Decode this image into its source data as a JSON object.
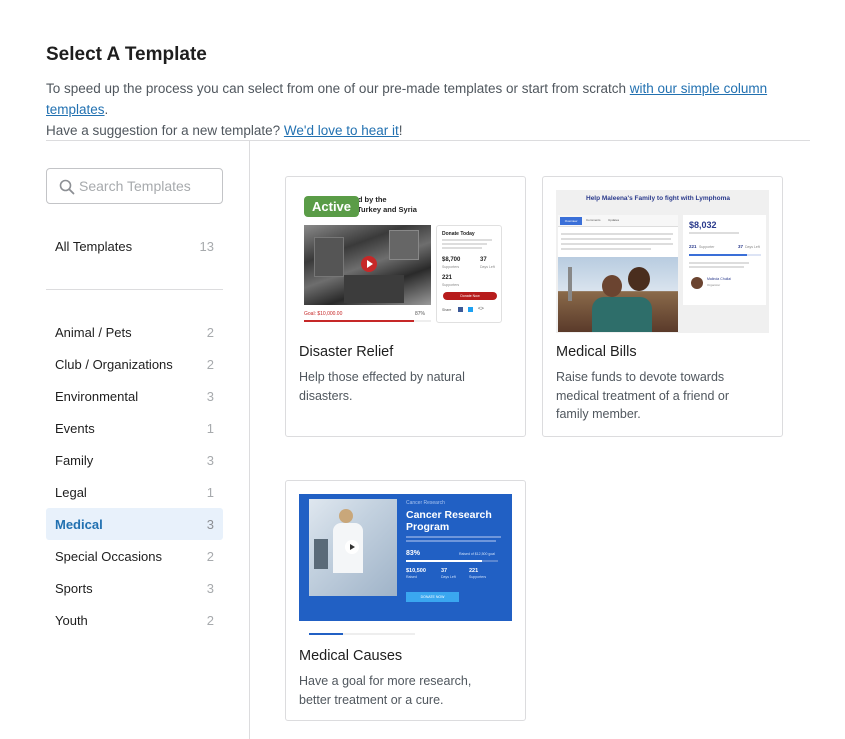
{
  "header": {
    "title": "Select A Template",
    "intro_text": "To speed up the process you can select from one of our pre-made templates or start from scratch ",
    "intro_link": "with our simple column templates",
    "intro_end": ".",
    "suggest_text": "Have a suggestion for a new template? ",
    "suggest_link": "We'd love to hear it",
    "suggest_end": "!"
  },
  "search": {
    "placeholder": "Search Templates"
  },
  "all_templates": {
    "label": "All Templates",
    "count": "13"
  },
  "categories": [
    {
      "label": "Animal / Pets",
      "count": "2"
    },
    {
      "label": "Club / Organizations",
      "count": "2"
    },
    {
      "label": "Environmental",
      "count": "3"
    },
    {
      "label": "Events",
      "count": "1"
    },
    {
      "label": "Family",
      "count": "3"
    },
    {
      "label": "Legal",
      "count": "1"
    },
    {
      "label": "Medical",
      "count": "3"
    },
    {
      "label": "Special Occasions",
      "count": "2"
    },
    {
      "label": "Sports",
      "count": "3"
    },
    {
      "label": "Youth",
      "count": "2"
    }
  ],
  "selected_category": "Medical",
  "cards": [
    {
      "title": "Disaster Relief",
      "description": "Help those effected by natural disasters.",
      "badge": "Active",
      "preview": {
        "heading_line1": "cted by the",
        "heading_line2": "Turkey and Syria",
        "donate_label": "Donate Today",
        "raised": "$8,700",
        "raised_label": "Supporters",
        "days": "37",
        "days_label": "Days Left",
        "supporters": "221",
        "supporters_label": "Supporters",
        "button": "Donate Now",
        "goal": "Goal: $10,000.00",
        "percent": "87%",
        "share": "Share"
      }
    },
    {
      "title": "Medical Bills",
      "description": "Raise funds to devote towards medical treatment of a friend or family member.",
      "preview": {
        "heading": "Help Maleena's Family to fight with Lymphoma",
        "tabs": [
          "Overview",
          "Comments",
          "Updates"
        ],
        "amount": "$8,032",
        "supporters": "221",
        "supporters_label": "Supporter",
        "days": "37",
        "days_label": "Days Left",
        "organizer_name": "Malinda Chullai",
        "organizer_role": "Organizer"
      }
    },
    {
      "title": "Medical Causes",
      "description": "Have a goal for more research, better treatment or a cure.",
      "preview": {
        "kicker": "Cancer Research",
        "heading_line1": "Cancer Research",
        "heading_line2": "Program",
        "percent": "83%",
        "raised": "$10,500",
        "raised_label": "Raised",
        "days": "37",
        "days_label": "Days Left",
        "supporters": "221",
        "supporters_label": "Supporters",
        "button": "DONATE NOW",
        "goal_label": "Raised of $12,500 goal"
      }
    }
  ],
  "colors": {
    "link": "#2271b1",
    "active_badge": "#5a9c47",
    "selected_bg": "#e8f1fb",
    "research_blue": "#2160c4"
  }
}
